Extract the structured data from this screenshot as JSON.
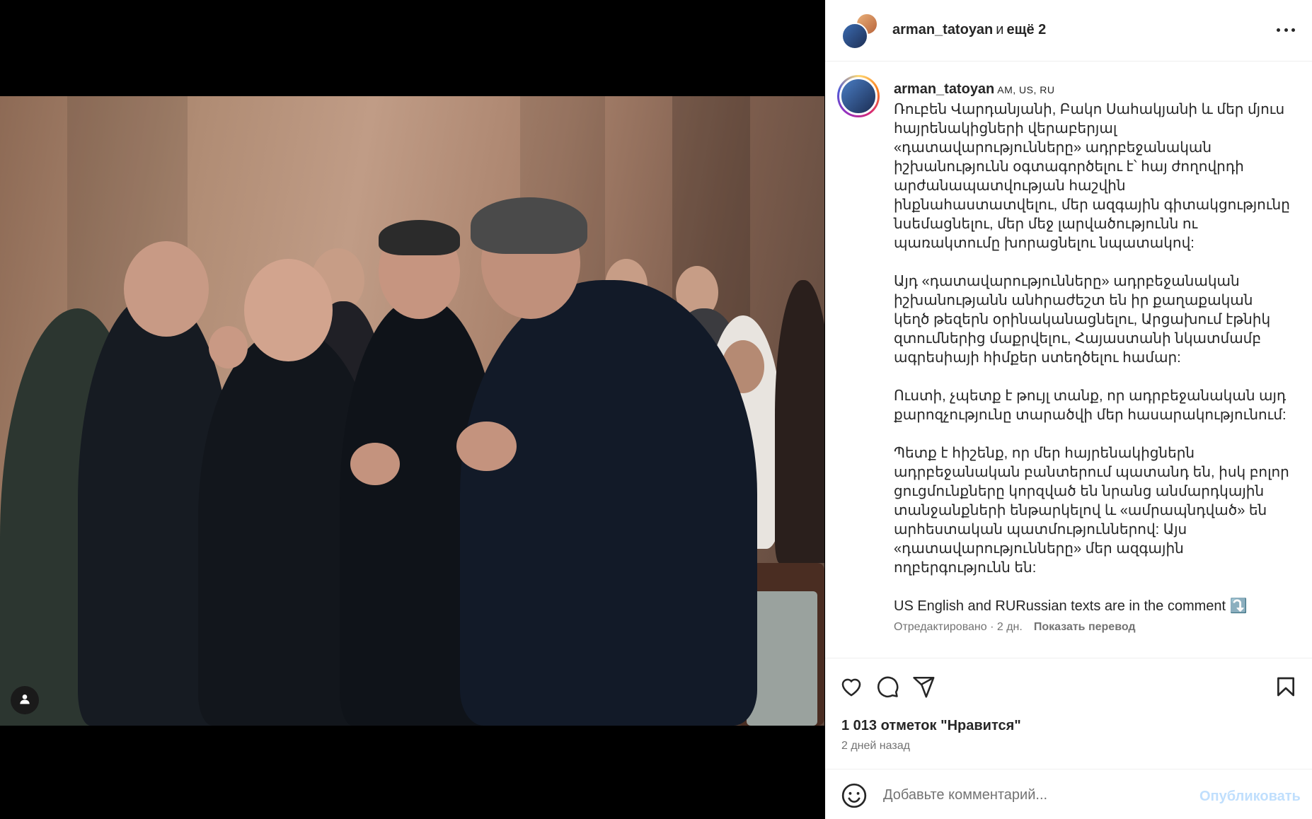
{
  "post": {
    "header": {
      "username": "arman_tatoyan",
      "and_text": "и",
      "others": "ещё 2"
    },
    "caption": {
      "username": "arman_tatoyan",
      "flags": "AM, US, RU",
      "text": "Ռուբեն Վարդանյանի, Բակո Սահակյանի և մեր մյուս հայրենակիցների վերաբերյալ «դատավարությունները» ադրբեջանական իշխանությունն օգտագործելու է՝ հայ ժողովրդի արժանապատվության հաշվին ինքնահաստատվելու, մեր ազգային գիտակցությունը նսեմացնելու, մեր մեջ լարվածությունն ու պառակտումը խորացնելու նպատակով:\n\nԱյդ «դատավարությունները» ադրբեջանական իշխանությանն անհրաժեշտ են իր քաղաքական կեղծ թեզերն օրինականացնելու, Արցախում էթնիկ զտումներից մաքրվելու, Հայաստանի նկատմամբ ագրեսիայի հիմքեր ստեղծելու համար:\n\nՈւստի, չպետք է թույլ տանք, որ ադրբեջանական այդ քարոզչությունը տարածվի մեր հասարակությունում:\n\nՊետք է հիշենք, որ մեր հայրենակիցներն ադրբեջանական բանտերում պատանդ են, իսկ բոլոր ցուցմունքները կորզված են նրանց անմարդկային տանջանքների ենթարկելով և «ամրապնդված» են արհեստական պատմություններով: Այս «դատավարությունները» մեր ազգային ողբերգությունն են:\n\nUS English and RURussian texts are in the comment ⤵️",
      "edited": "Отредактировано · 2 дн.",
      "translate": "Показать перевод"
    },
    "likes": "1 013 отметок \"Нравится\"",
    "date": "2 дней назад",
    "comment": {
      "placeholder": "Добавьте комментарий...",
      "publish": "Опубликовать"
    }
  },
  "icons": {
    "more": "more-options-icon",
    "like": "heart-icon",
    "comment": "comment-icon",
    "share": "send-icon",
    "save": "bookmark-icon",
    "emoji": "emoji-icon",
    "tagged": "user-icon"
  },
  "colors": {
    "text_primary": "#262626",
    "text_secondary": "#737373",
    "publish_disabled": "#c0dffd",
    "border": "#efefef",
    "photo_bg": "#000000"
  }
}
